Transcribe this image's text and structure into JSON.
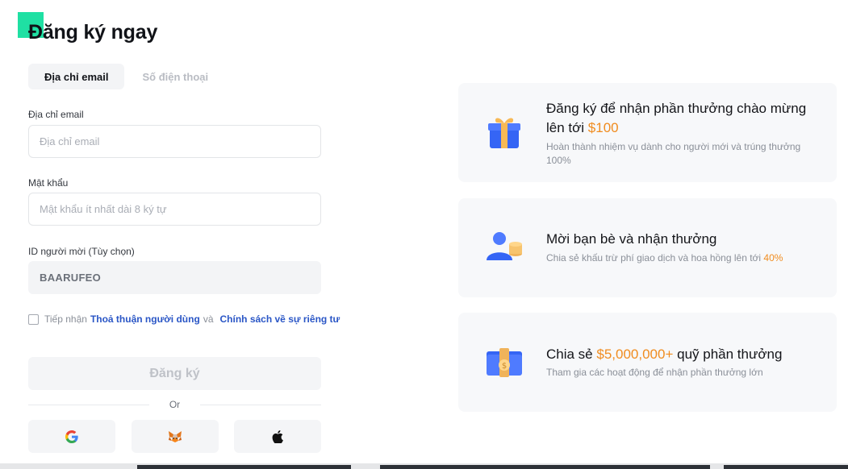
{
  "page": {
    "title": "Đăng ký ngay"
  },
  "tabs": [
    {
      "label": "Địa chỉ email",
      "active": true
    },
    {
      "label": "Số điện thoại",
      "active": false
    }
  ],
  "form": {
    "email": {
      "label": "Địa chỉ email",
      "placeholder": "Địa chỉ email",
      "value": ""
    },
    "password": {
      "label": "Mật khẩu",
      "placeholder": "Mật khẩu ít nhất dài 8 ký tự",
      "value": ""
    },
    "referral": {
      "label": "ID người mời (Tùy chọn)",
      "value": "BAARUFEO"
    },
    "agree": {
      "prefix": "Tiếp nhận",
      "terms_link": "Thoả thuận người dùng",
      "conjunction": "và",
      "privacy_link": "Chính sách về sự riêng tư",
      "checked": false
    },
    "submit_label": "Đăng ký",
    "divider_text": "Or"
  },
  "social": [
    {
      "name": "google-icon"
    },
    {
      "name": "metamask-fox-icon"
    },
    {
      "name": "apple-icon"
    }
  ],
  "promos": [
    {
      "title_text": "Đăng ký để nhận phần thưởng chào mừng lên tới",
      "title_highlight": "$100",
      "desc_text": "Hoàn thành nhiệm vụ dành cho người mới và trúng thưởng 100%",
      "icon": "gift-box-icon"
    },
    {
      "title_text": "Mời bạn bè và nhận thưởng",
      "desc_text": "Chia sẻ khấu trừ phí giao dịch và hoa hồng lên tới",
      "desc_highlight": "40%",
      "icon": "invite-friends-coins-icon"
    },
    {
      "title_prefix": "Chia sẻ",
      "title_highlight": "$5,000,000+",
      "title_suffix": "quỹ phần thưởng",
      "desc_text": "Tham gia các hoạt động để nhận phần thưởng lớn",
      "icon": "money-stack-icon"
    }
  ],
  "colors": {
    "brand": "#1fe0a3",
    "accent": "#f08c1f",
    "link": "#2a56c6",
    "card_bg": "#f7f8fa"
  }
}
